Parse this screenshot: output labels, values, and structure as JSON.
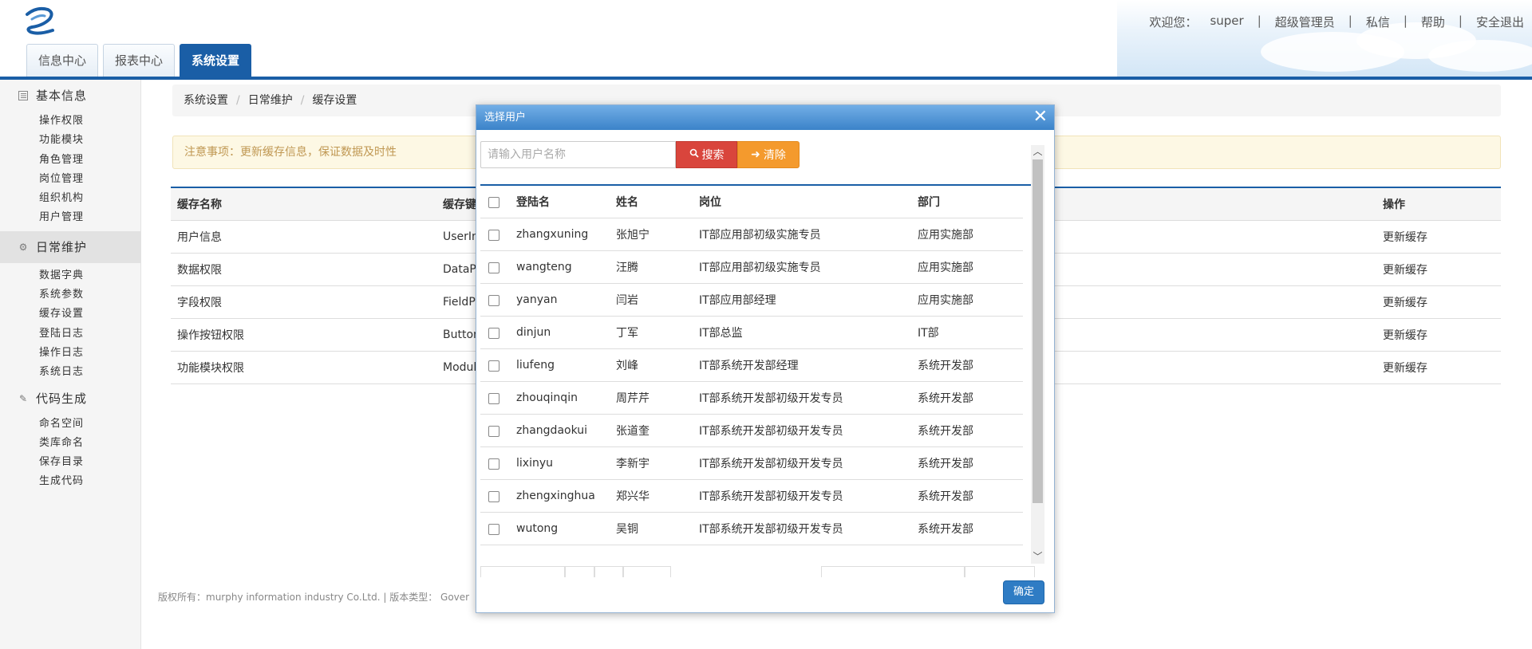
{
  "header": {
    "welcome": "欢迎您：",
    "user": "super",
    "links": [
      "超级管理员",
      "私信",
      "帮助",
      "安全退出"
    ],
    "tabs": [
      "信息中心",
      "报表中心",
      "系统设置"
    ],
    "active_tab": 2
  },
  "sidebar": {
    "groups": [
      {
        "label": "基本信息",
        "icon": "grid-icon",
        "items": [
          "操作权限",
          "功能模块",
          "角色管理",
          "岗位管理",
          "组织机构",
          "用户管理"
        ]
      },
      {
        "label": "日常维护",
        "icon": "gear-icon",
        "items": [
          "数据字典",
          "系统参数",
          "缓存设置",
          "登陆日志",
          "操作日志",
          "系统日志"
        ]
      },
      {
        "label": "代码生成",
        "icon": "pencil-icon",
        "items": [
          "命名空间",
          "类库命名",
          "保存目录",
          "生成代码"
        ]
      }
    ],
    "active_group": 1
  },
  "breadcrumb": [
    "系统设置",
    "日常维护",
    "缓存设置"
  ],
  "notice": "注意事项：更新缓存信息，保证数据及时性",
  "cache_table": {
    "headers": [
      "缓存名称",
      "缓存键",
      "操作"
    ],
    "rows": [
      {
        "name": "用户信息",
        "key": "UserIn",
        "action": "更新缓存"
      },
      {
        "name": "数据权限",
        "key": "DataP",
        "action": "更新缓存"
      },
      {
        "name": "字段权限",
        "key": "FieldP",
        "action": "更新缓存"
      },
      {
        "name": "操作按钮权限",
        "key": "Button",
        "action": "更新缓存"
      },
      {
        "name": "功能模块权限",
        "key": "Modul",
        "action": "更新缓存"
      }
    ]
  },
  "footer": "版权所有：murphy information industry Co.Ltd. | 版本类型： Gover",
  "modal": {
    "title": "选择用户",
    "search_placeholder": "请输入用户名称",
    "search_label": "搜索",
    "clear_label": "清除",
    "ok_label": "确定",
    "headers": [
      "登陆名",
      "姓名",
      "岗位",
      "部门"
    ],
    "users": [
      {
        "login": "zhangxuning",
        "name": "张旭宁",
        "post": "IT部应用部初级实施专员",
        "dept": "应用实施部"
      },
      {
        "login": "wangteng",
        "name": "汪腾",
        "post": "IT部应用部初级实施专员",
        "dept": "应用实施部"
      },
      {
        "login": "yanyan",
        "name": "闫岩",
        "post": "IT部应用部经理",
        "dept": "应用实施部"
      },
      {
        "login": "dinjun",
        "name": "丁军",
        "post": "IT部总监",
        "dept": "IT部"
      },
      {
        "login": "liufeng",
        "name": "刘峰",
        "post": "IT部系统开发部经理",
        "dept": "系统开发部"
      },
      {
        "login": "zhouqinqin",
        "name": "周芹芹",
        "post": "IT部系统开发部初级开发专员",
        "dept": "系统开发部"
      },
      {
        "login": "zhangdaokui",
        "name": "张道奎",
        "post": "IT部系统开发部初级开发专员",
        "dept": "系统开发部"
      },
      {
        "login": "lixinyu",
        "name": "李新宇",
        "post": "IT部系统开发部初级开发专员",
        "dept": "系统开发部"
      },
      {
        "login": "zhengxinghua",
        "name": "郑兴华",
        "post": "IT部系统开发部初级开发专员",
        "dept": "系统开发部"
      },
      {
        "login": "wutong",
        "name": "吴铜",
        "post": "IT部系统开发部初级开发专员",
        "dept": "系统开发部"
      }
    ]
  }
}
